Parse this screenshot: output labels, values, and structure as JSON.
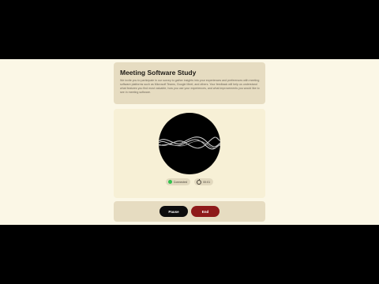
{
  "header": {
    "title": "Meeting Software Study",
    "description": "We invite you to participate in our survey to gather insights into your experiences and preferences with meeting software platforms such as Microsoft Teams, Google Meet, and others. Your feedback will help us understand what features you find most valuable, how you use your experiences, and what improvements you would like to see in meeting software."
  },
  "status": {
    "connection_label": "Connected",
    "timer_value": "00:01"
  },
  "controls": {
    "pause_label": "Pause",
    "end_label": "End"
  },
  "colors": {
    "page_background": "#fbf7e6",
    "card_background": "#e6dcc1",
    "connected_dot": "#33c24d",
    "end_button": "#8e1a1a",
    "pause_button": "#0d0d0d"
  },
  "icons": {
    "status": "status-dot-icon",
    "timer": "timer-icon"
  }
}
